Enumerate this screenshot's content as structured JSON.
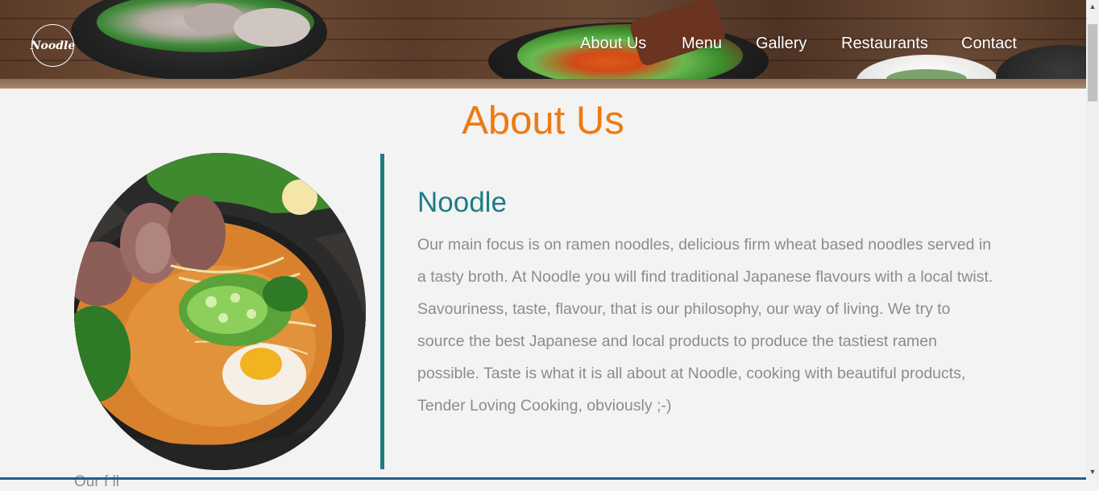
{
  "header": {
    "logo_text": "Noodle",
    "nav": [
      {
        "label": "About Us"
      },
      {
        "label": "Menu"
      },
      {
        "label": "Gallery"
      },
      {
        "label": "Restaurants"
      },
      {
        "label": "Contact"
      }
    ]
  },
  "main": {
    "title": "About Us",
    "section": {
      "heading": "Noodle",
      "body": "Our main focus is on ramen noodles, delicious firm wheat based noodles served in a tasty broth. At Noodle you will find traditional Japanese flavours with a local twist. Savouriness, taste, flavour, that is our philosophy, our way of living. We try to source the best Japanese and local products to produce the tastiest ramen possible. Taste is what it is all about at Noodle, cooking with beautiful products, Tender Loving Cooking, obviously ;-)"
    },
    "cut_off_text": "Our  f             ll  "
  },
  "colors": {
    "accent_orange": "#ee7a12",
    "accent_teal": "#1d7d84",
    "body_text": "#8c8c8c",
    "page_bg": "#f3f3f3"
  },
  "icons": {
    "scroll_up": "scroll-up-arrow-icon",
    "scroll_down": "scroll-down-arrow-icon"
  }
}
